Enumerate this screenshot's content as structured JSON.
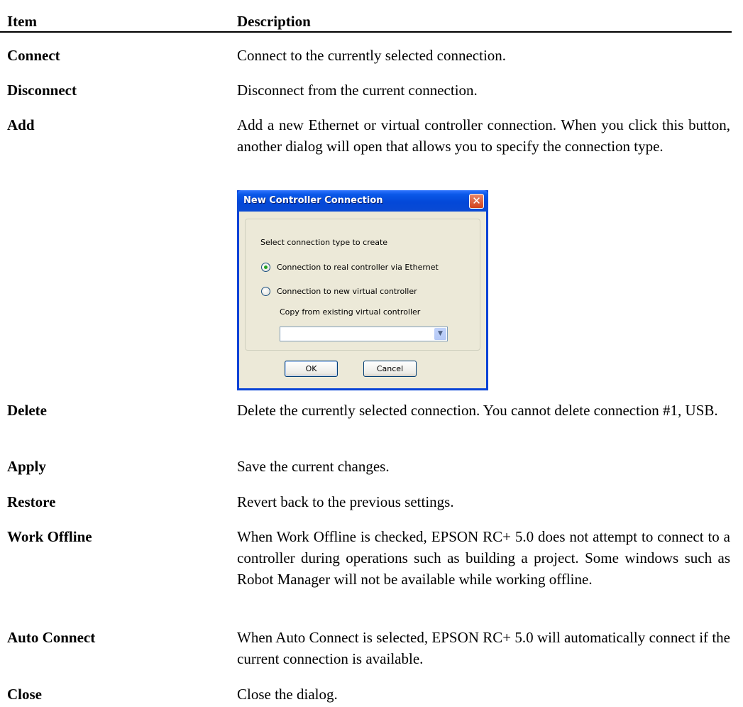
{
  "header": {
    "item": "Item",
    "description": "Description"
  },
  "rows": [
    {
      "item": "Connect",
      "description": "Connect to the currently selected connection."
    },
    {
      "item": "Disconnect",
      "description": "Disconnect from the current connection."
    },
    {
      "item": "Add",
      "description": "Add a new Ethernet or virtual controller connection.  When you click this button, another dialog will open that allows you to specify the connection type."
    },
    {
      "item": "Delete",
      "description": "Delete the currently selected connection.  You cannot delete connection #1, USB."
    },
    {
      "item": "Apply",
      "description": "Save the current changes."
    },
    {
      "item": "Restore",
      "description": "Revert back to the previous settings."
    },
    {
      "item": "Work Offline",
      "description": "When Work Offline is checked, EPSON RC+ 5.0 does not attempt to connect to a controller during operations such as building a project.  Some windows such as Robot Manager will not be available while working offline."
    },
    {
      "item": "Auto Connect",
      "description": "When Auto Connect is selected, EPSON RC+ 5.0 will automatically connect if the current connection is available."
    },
    {
      "item": "Close",
      "description": "Close the dialog."
    }
  ],
  "dialog": {
    "title": "New Controller Connection",
    "close_icon": "close-icon",
    "prompt": "Select connection type to create",
    "option_ethernet": "Connection to real controller via Ethernet",
    "option_virtual": "Connection to new virtual controller",
    "selected_option": "ethernet",
    "copy_label": "Copy from existing virtual controller",
    "copy_value": "",
    "ok_label": "OK",
    "cancel_label": "Cancel"
  }
}
